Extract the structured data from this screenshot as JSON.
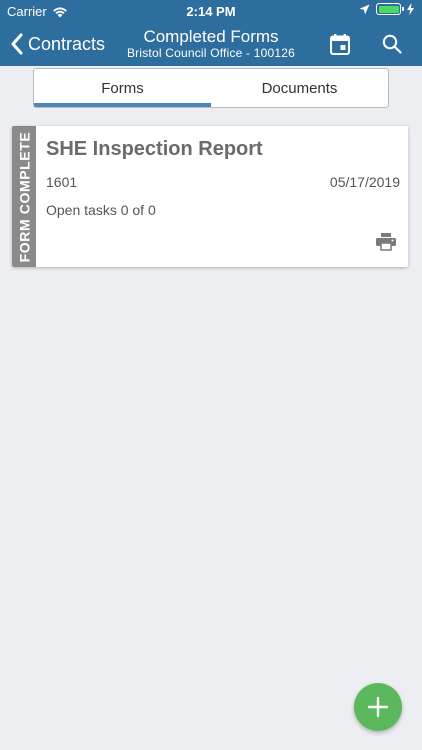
{
  "status_bar": {
    "carrier": "Carrier",
    "time": "2:14 PM",
    "battery_color": "#4cd964"
  },
  "nav": {
    "back_label": "Contracts",
    "title": "Completed Forms",
    "subtitle": "Bristol Council Office - 100126",
    "icons": [
      "back-chevron-icon",
      "calendar-icon",
      "search-icon"
    ]
  },
  "tabs": [
    {
      "label": "Forms",
      "active": true
    },
    {
      "label": "Documents",
      "active": false
    }
  ],
  "forms": [
    {
      "status_label": "FORM COMPLETE",
      "title": "SHE Inspection Report",
      "id": "1601",
      "date": "05/17/2019",
      "open_tasks": "Open tasks 0 of 0",
      "icon": "print-icon"
    }
  ],
  "fab": {
    "icon": "plus-icon",
    "color": "#5cb85c"
  },
  "colors": {
    "header": "#2e6e9e",
    "tab_indicator": "#4e86b5",
    "background": "#eceef1",
    "status_strip": "#8a8a8a"
  }
}
